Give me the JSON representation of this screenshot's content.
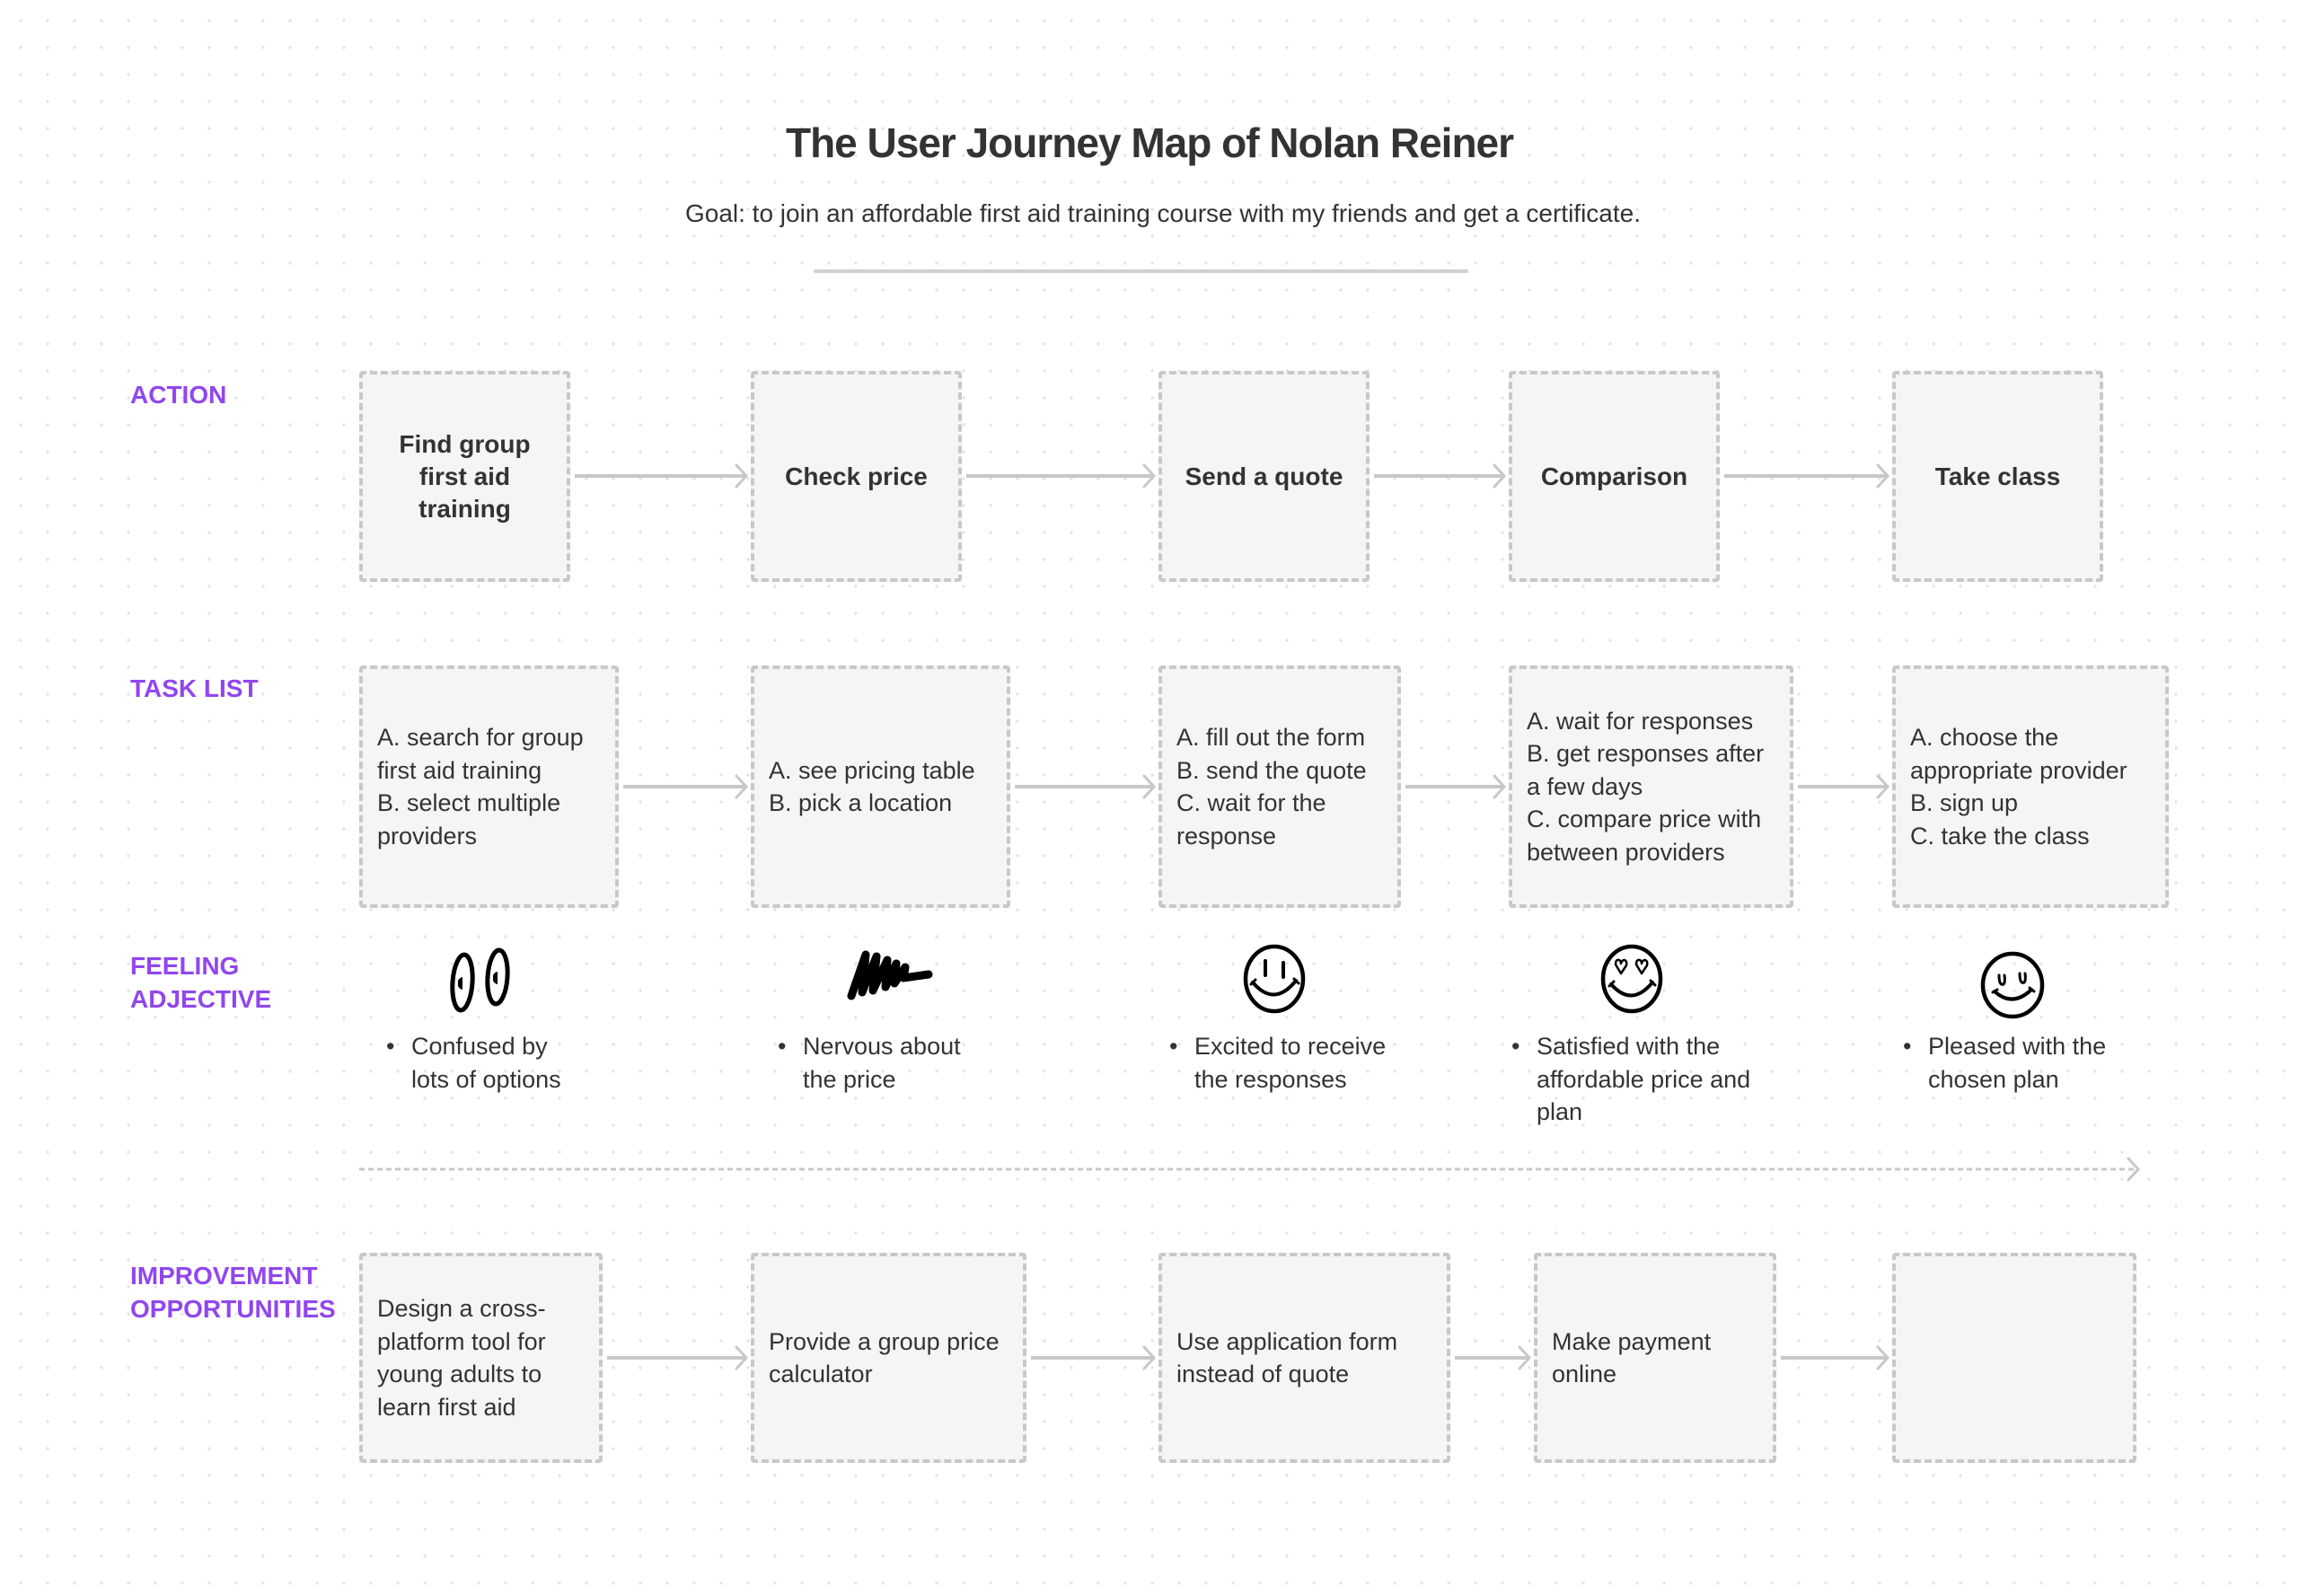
{
  "header": {
    "title": "The User Journey Map of Nolan Reiner",
    "goal": "Goal: to join an affordable first aid training course with my friends and get a certificate."
  },
  "colors": {
    "label_accent": "#9146ee",
    "box_border": "#c8c8c8",
    "box_fill": "#f5f5f5",
    "arrow": "#c8c8c8",
    "text": "#333333"
  },
  "rows": {
    "action": {
      "label": "ACTION",
      "items": [
        "Find group first aid training",
        "Check price",
        "Send a quote",
        "Comparison",
        "Take class"
      ]
    },
    "task_list": {
      "label": "TASK LIST",
      "items": [
        "A. search for group\nfirst aid training\nB. select multiple\nproviders",
        "A. see pricing table\nB. pick a location",
        "A. fill out the form\nB. send the quote\nC. wait for the\nresponse",
        "A. wait for responses\nB. get responses after\na few days\nC. compare price with\nbetween providers",
        "A. choose the\nappropriate provider\nB. sign up\nC. take the class"
      ]
    },
    "feeling": {
      "label_line1": "FEELING",
      "label_line2": "ADJECTIVE",
      "items": [
        {
          "icon": "confused-eyes-icon",
          "text": "Confused by\nlots of options"
        },
        {
          "icon": "nervous-scribble-icon",
          "text": "Nervous about\nthe price"
        },
        {
          "icon": "excited-smiley-icon",
          "text": "Excited to receive\nthe responses"
        },
        {
          "icon": "heart-eyes-smiley-icon",
          "text": "Satisfied with the\naffordable price and\nplan"
        },
        {
          "icon": "content-smiley-icon",
          "text": "Pleased with the\nchosen plan"
        }
      ]
    },
    "improvement": {
      "label_line1": "IMPROVEMENT",
      "label_line2": "OPPORTUNITIES",
      "items": [
        "Design a cross-\nplatform tool for\nyoung adults to\nlearn first aid",
        "Provide a group price\ncalculator",
        "Use application form\ninstead of quote",
        "Make payment\nonline",
        ""
      ]
    }
  },
  "bullet_char": "•"
}
